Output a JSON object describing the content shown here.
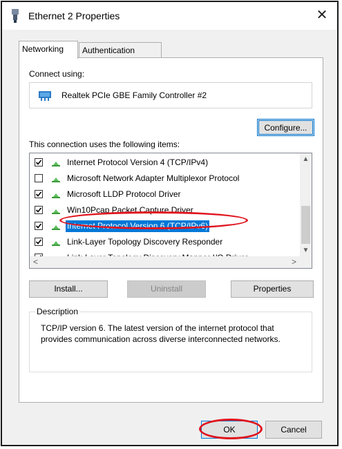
{
  "window": {
    "title": "Ethernet 2 Properties",
    "close_glyph": "✕"
  },
  "tabs": [
    {
      "label": "Networking",
      "active": true
    },
    {
      "label": "Authentication",
      "active": false
    }
  ],
  "connect": {
    "label": "Connect using:",
    "adapter": "Realtek PCIe GBE Family Controller #2",
    "configure_label": "Configure..."
  },
  "items": {
    "label": "This connection uses the following items:",
    "list": [
      {
        "label": "Internet Protocol Version 4 (TCP/IPv4)",
        "checked": true
      },
      {
        "label": "Microsoft Network Adapter Multiplexor Protocol",
        "checked": false
      },
      {
        "label": "Microsoft LLDP Protocol Driver",
        "checked": true
      },
      {
        "label": "Win10Pcap Packet Capture Driver",
        "checked": true
      },
      {
        "label": "Internet Protocol Version 6 (TCP/IPv6)",
        "checked": true,
        "selected": true
      },
      {
        "label": "Link-Layer Topology Discovery Responder",
        "checked": true
      },
      {
        "label": "Link-Layer Topology Discovery Mapper I/O Driver",
        "checked": true
      }
    ]
  },
  "actions": {
    "install": "Install...",
    "uninstall": "Uninstall",
    "properties": "Properties"
  },
  "description": {
    "title": "Description",
    "text": "TCP/IP version 6. The latest version of the internet protocol that provides communication across diverse interconnected networks."
  },
  "footer": {
    "ok": "OK",
    "cancel": "Cancel"
  },
  "colors": {
    "selection": "#0078d7",
    "highlight_annotation": "#e0141e"
  }
}
